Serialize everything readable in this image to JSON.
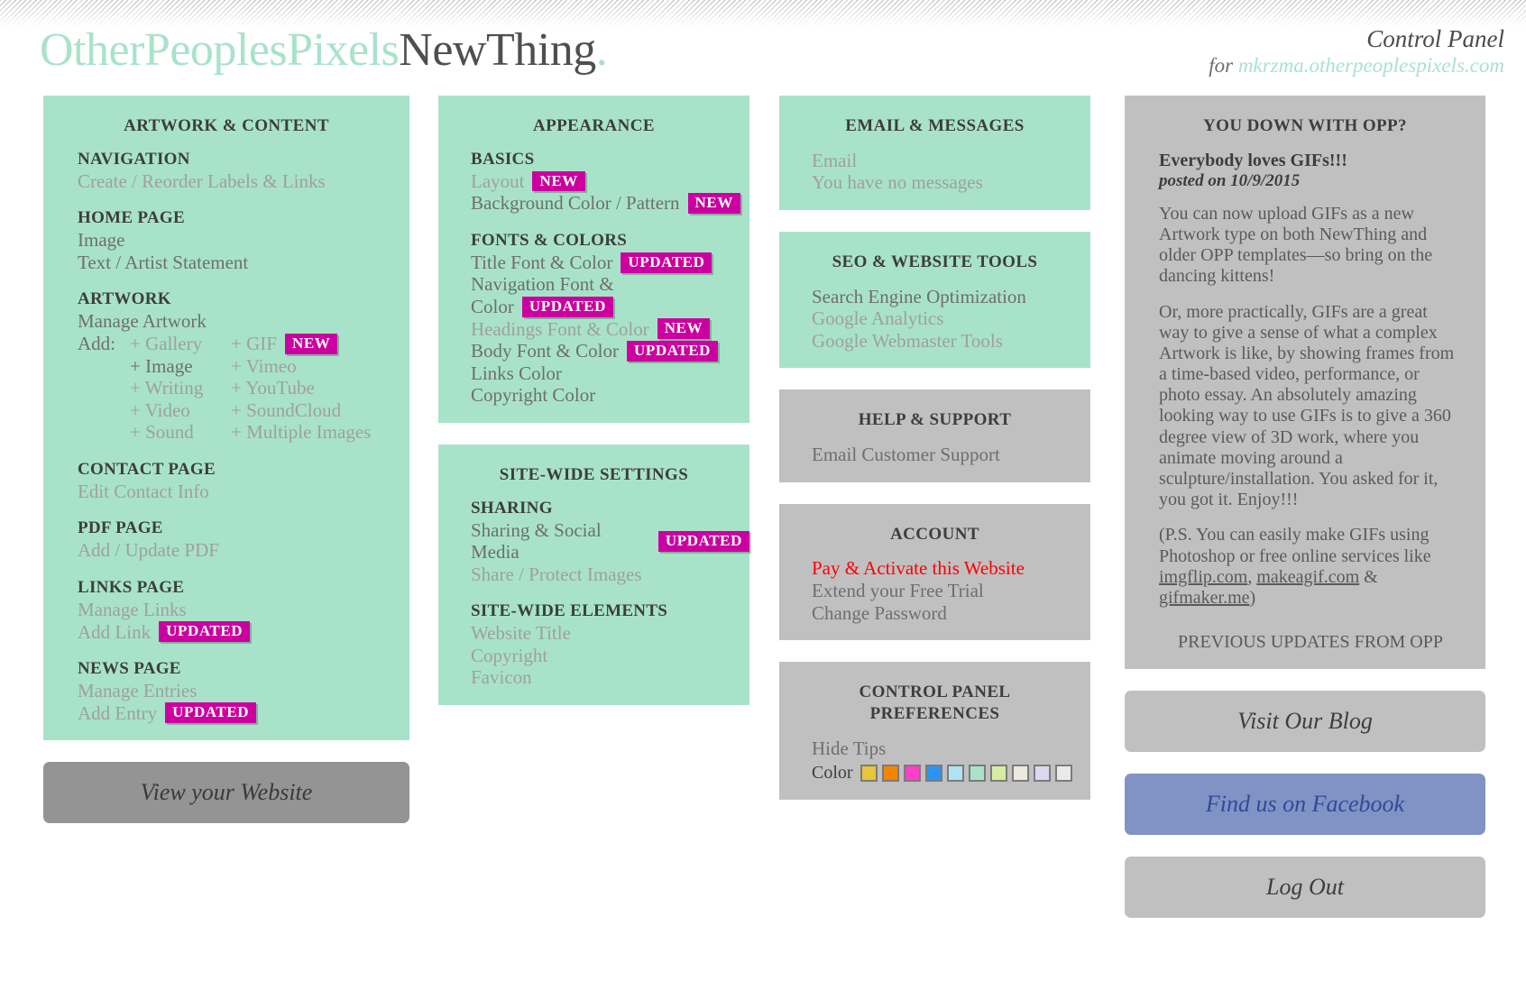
{
  "header": {
    "logo_part1": "OtherPeoplesPixels",
    "logo_part2": "NewThing",
    "logo_dot": ".",
    "control_panel_title": "Control Panel",
    "for_label": "for",
    "domain": "mkrzma.otherpeoplespixels.com"
  },
  "artwork_content": {
    "panel_title": "ARTWORK & CONTENT",
    "navigation_head": "NAVIGATION",
    "navigation_link": "Create / Reorder Labels & Links",
    "home_head": "HOME PAGE",
    "home_image": "Image",
    "home_text": "Text / Artist Statement",
    "artwork_head": "ARTWORK",
    "manage_artwork": "Manage Artwork",
    "add_label": "Add:",
    "add_left": [
      "+ Gallery",
      "+ Image",
      "+ Writing",
      "+ Video",
      "+ Sound"
    ],
    "add_right": [
      "+ GIF",
      "+ Vimeo",
      "+ YouTube",
      "+ SoundCloud",
      "+ Multiple Images"
    ],
    "gif_badge": "NEW",
    "contact_head": "CONTACT PAGE",
    "contact_link": "Edit Contact Info",
    "pdf_head": "PDF PAGE",
    "pdf_link": "Add / Update PDF",
    "links_head": "LINKS PAGE",
    "manage_links": "Manage Links",
    "add_link": "Add Link",
    "add_link_badge": "UPDATED",
    "news_head": "NEWS PAGE",
    "manage_entries": "Manage Entries",
    "add_entry": "Add Entry",
    "add_entry_badge": "UPDATED"
  },
  "appearance": {
    "panel_title": "APPEARANCE",
    "basics_head": "BASICS",
    "layout": "Layout",
    "layout_badge": "NEW",
    "background": "Background Color / Pattern",
    "background_badge": "NEW",
    "fonts_head": "FONTS & COLORS",
    "title_font": "Title Font & Color",
    "title_font_badge": "UPDATED",
    "nav_font_line1": "Navigation Font &",
    "nav_font_line2": "Color",
    "nav_font_badge": "UPDATED",
    "headings_font": "Headings Font & Color",
    "headings_font_badge": "NEW",
    "body_font": "Body Font & Color",
    "body_font_badge": "UPDATED",
    "links_color": "Links Color",
    "copyright_color": "Copyright Color"
  },
  "site_wide": {
    "panel_title": "SITE-WIDE SETTINGS",
    "sharing_head": "SHARING",
    "sharing_social": "Sharing & Social Media",
    "sharing_badge": "UPDATED",
    "share_protect": "Share / Protect Images",
    "elements_head": "SITE-WIDE ELEMENTS",
    "website_title": "Website Title",
    "copyright": "Copyright",
    "favicon": "Favicon"
  },
  "email_messages": {
    "panel_title": "EMAIL & MESSAGES",
    "email": "Email",
    "no_messages": "You have no messages"
  },
  "seo": {
    "panel_title": "SEO & WEBSITE TOOLS",
    "search_engine": "Search Engine Optimization",
    "google_analytics": "Google Analytics",
    "google_webmaster": "Google Webmaster Tools"
  },
  "help": {
    "panel_title": "HELP & SUPPORT",
    "email_support": "Email Customer Support"
  },
  "account": {
    "panel_title": "ACCOUNT",
    "pay_activate": "Pay & Activate this Website",
    "extend_trial": "Extend your Free Trial",
    "change_password": "Change Password"
  },
  "preferences": {
    "panel_title_line1": "CONTROL PANEL",
    "panel_title_line2": "PREFERENCES",
    "hide_tips": "Hide Tips",
    "color_label": "Color",
    "swatches": [
      "#e8c53a",
      "#f58400",
      "#ff3fc8",
      "#2a95f5",
      "#aee4ef",
      "#a9e3c8",
      "#d6eda1",
      "#ece9dd",
      "#dcd8f2",
      "#eaeaea"
    ]
  },
  "news": {
    "panel_title": "YOU DOWN WITH OPP?",
    "post_title": "Everybody loves GIFs!!!",
    "post_date": "posted on 10/9/2015",
    "para1": "You can now upload GIFs as a new Artwork type on both NewThing and older OPP templates—so bring on the dancing kittens!",
    "para2": "Or, more practically, GIFs are a great way to give a sense of what a complex Artwork is like, by showing frames from a time-based video, performance, or photo essay. An absolutely amazing looking way to use GIFs is to give a 360 degree view of 3D work, where you animate moving around a sculpture/installation. You asked for it, you got it. Enjoy!!!",
    "para3_pre": "(P.S. You can easily make GIFs using Photoshop or free online services like ",
    "link1": "imgflip.com",
    "para3_mid1": ", ",
    "link2": "makeagif.com",
    "para3_mid2": " & ",
    "link3": "gifmaker.me",
    "para3_post": ")",
    "previous_updates": "PREVIOUS UPDATES FROM OPP"
  },
  "buttons": {
    "view_website": "View your Website",
    "visit_blog": "Visit Our Blog",
    "find_facebook": "Find us on Facebook",
    "log_out": "Log Out"
  }
}
